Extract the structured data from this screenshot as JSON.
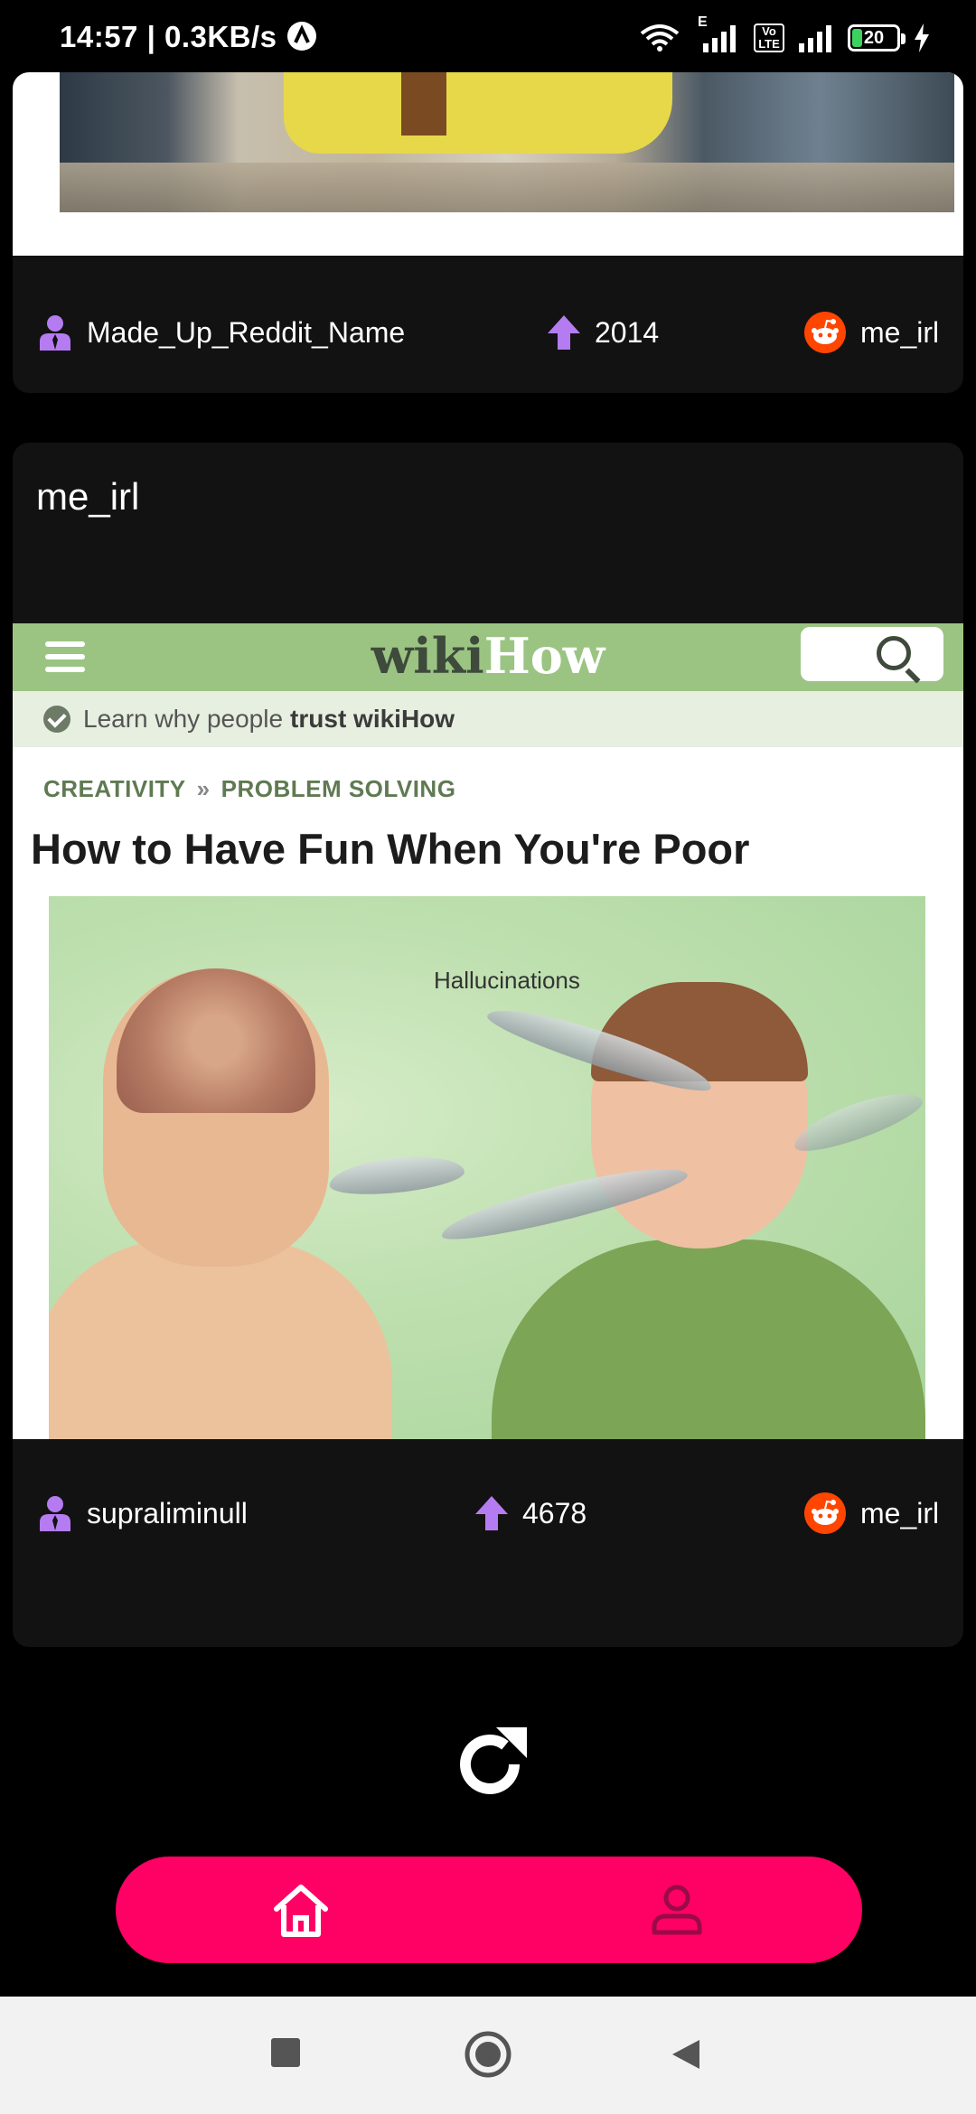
{
  "status_bar": {
    "time": "14:57",
    "speed": "| 0.3KB/s",
    "network_label": "E",
    "volte_label": "Vo LTE",
    "battery_level": "20"
  },
  "posts": [
    {
      "author": "Made_Up_Reddit_Name",
      "score": "2014",
      "subreddit": "me_irl"
    },
    {
      "title": "me_irl",
      "author": "supraliminull",
      "score": "4678",
      "subreddit": "me_irl",
      "image_text": {
        "logo_part1": "wiki",
        "logo_part2": "How",
        "trust_text": "Learn why people",
        "trust_bold": "trust wikiHow",
        "breadcrumb_1": "CREATIVITY",
        "breadcrumb_sep": "»",
        "breadcrumb_2": "PROBLEM SOLVING",
        "headline": "How to Have Fun When You're Poor",
        "illustration_label": "Hallucinations"
      }
    }
  ],
  "colors": {
    "accent": "#ff0064",
    "icon_purple": "#b57cf2",
    "reddit_orange": "#ff4500",
    "card_bg": "#121212"
  },
  "icons": {
    "author": "person-tie-icon",
    "score": "arrow-up-icon",
    "subreddit": "reddit-icon",
    "refresh": "refresh-icon",
    "home": "home-icon",
    "profile": "person-icon"
  }
}
